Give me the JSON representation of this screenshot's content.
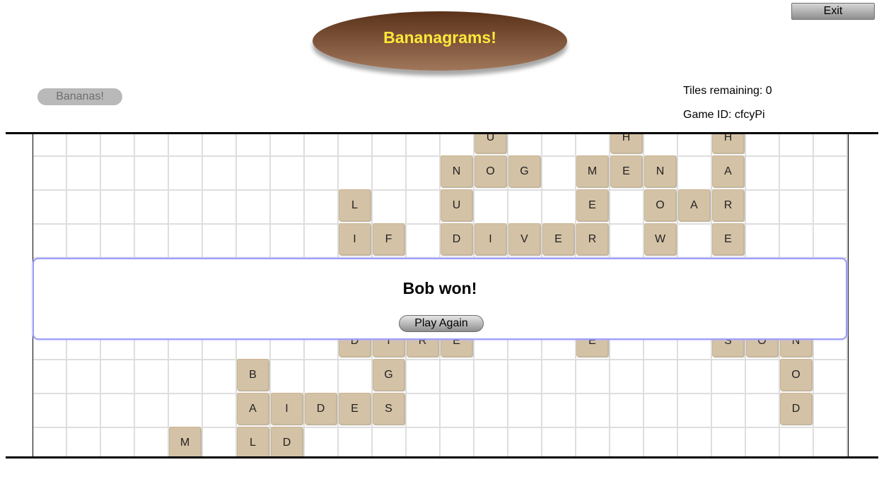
{
  "header": {
    "exit_label": "Exit",
    "title": "Bananagrams!",
    "bananas_label": "Bananas!",
    "tiles_remaining": "Tiles remaining: 0",
    "game_id": "Game ID: cfcyPi"
  },
  "dialog": {
    "message": "Bob won!",
    "play_again_label": "Play Again"
  },
  "colors": {
    "tile": "#d4c2a6",
    "title_text": "#ffe83a",
    "title_oval": "#7a5034",
    "dialog_border": "#9d9dfb"
  },
  "board": {
    "tiles": [
      {
        "letter": "U",
        "col": 13,
        "row": 0
      },
      {
        "letter": "H",
        "col": 17,
        "row": 0
      },
      {
        "letter": "H",
        "col": 20,
        "row": 0
      },
      {
        "letter": "N",
        "col": 12,
        "row": 1
      },
      {
        "letter": "O",
        "col": 13,
        "row": 1
      },
      {
        "letter": "G",
        "col": 14,
        "row": 1
      },
      {
        "letter": "M",
        "col": 16,
        "row": 1
      },
      {
        "letter": "E",
        "col": 17,
        "row": 1
      },
      {
        "letter": "N",
        "col": 18,
        "row": 1
      },
      {
        "letter": "A",
        "col": 20,
        "row": 1
      },
      {
        "letter": "L",
        "col": 9,
        "row": 2
      },
      {
        "letter": "U",
        "col": 12,
        "row": 2
      },
      {
        "letter": "E",
        "col": 16,
        "row": 2
      },
      {
        "letter": "O",
        "col": 18,
        "row": 2
      },
      {
        "letter": "A",
        "col": 19,
        "row": 2
      },
      {
        "letter": "R",
        "col": 20,
        "row": 2
      },
      {
        "letter": "I",
        "col": 9,
        "row": 3
      },
      {
        "letter": "F",
        "col": 10,
        "row": 3
      },
      {
        "letter": "D",
        "col": 12,
        "row": 3
      },
      {
        "letter": "I",
        "col": 13,
        "row": 3
      },
      {
        "letter": "V",
        "col": 14,
        "row": 3
      },
      {
        "letter": "E",
        "col": 15,
        "row": 3
      },
      {
        "letter": "R",
        "col": 16,
        "row": 3
      },
      {
        "letter": "W",
        "col": 18,
        "row": 3
      },
      {
        "letter": "E",
        "col": 20,
        "row": 3
      },
      {
        "letter": "D",
        "col": 9,
        "row": 6
      },
      {
        "letter": "I",
        "col": 10,
        "row": 6
      },
      {
        "letter": "R",
        "col": 11,
        "row": 6
      },
      {
        "letter": "E",
        "col": 12,
        "row": 6
      },
      {
        "letter": "E",
        "col": 16,
        "row": 6
      },
      {
        "letter": "S",
        "col": 20,
        "row": 6
      },
      {
        "letter": "O",
        "col": 21,
        "row": 6
      },
      {
        "letter": "N",
        "col": 22,
        "row": 6
      },
      {
        "letter": "B",
        "col": 6,
        "row": 7
      },
      {
        "letter": "G",
        "col": 10,
        "row": 7
      },
      {
        "letter": "O",
        "col": 22,
        "row": 7
      },
      {
        "letter": "A",
        "col": 6,
        "row": 8
      },
      {
        "letter": "I",
        "col": 7,
        "row": 8
      },
      {
        "letter": "D",
        "col": 8,
        "row": 8
      },
      {
        "letter": "E",
        "col": 9,
        "row": 8
      },
      {
        "letter": "S",
        "col": 10,
        "row": 8
      },
      {
        "letter": "D",
        "col": 22,
        "row": 8
      },
      {
        "letter": "M",
        "col": 4,
        "row": 9
      },
      {
        "letter": "L",
        "col": 6,
        "row": 9
      },
      {
        "letter": "D",
        "col": 7,
        "row": 9
      }
    ]
  }
}
